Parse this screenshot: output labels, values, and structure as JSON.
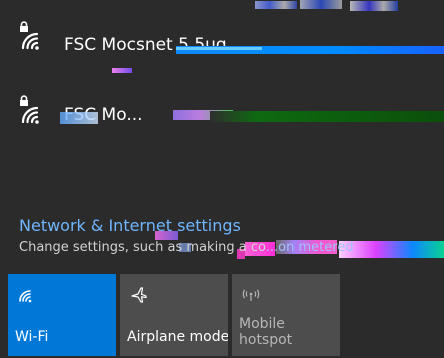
{
  "networks": [
    {
      "name": "FSC Mocsnet 5.5ug",
      "secured": true,
      "icon": "wifi-lock-icon"
    },
    {
      "name": "FSC Mo...",
      "secured": true,
      "icon": "wifi-lock-icon"
    }
  ],
  "settings": {
    "title": "Network & Internet settings",
    "subtitle_prefix": "Change settings, such as making a co",
    "subtitle_suffix": "...on metered"
  },
  "tiles": [
    {
      "label_line_1": "Wi-Fi",
      "label_line_2": "",
      "icon": "wifi-icon"
    },
    {
      "label_line_1": "Airplane mode",
      "label_line_2": "",
      "icon": "airplane-icon"
    },
    {
      "label_line_1": "Mobile",
      "label_line_2": "hotspot",
      "icon": "hotspot-icon"
    }
  ],
  "colors": {
    "background": "#2b2b2b",
    "accent": "#0078d7",
    "link": "#6fb6ff",
    "tile_inactive": "#4d4d4d",
    "text_primary": "#ffffff",
    "text_secondary": "#d2d2d2",
    "text_disabled": "#b6b6b6"
  }
}
